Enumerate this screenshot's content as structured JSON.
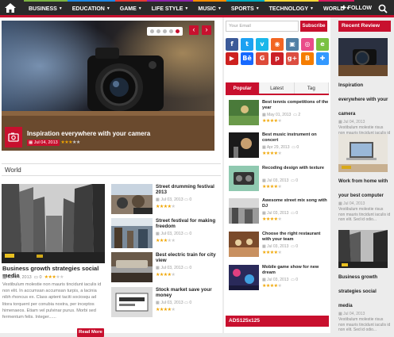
{
  "nav": {
    "items": [
      {
        "label": "BUSINESS",
        "accent": "#7cb342"
      },
      {
        "label": "EDUCATION",
        "accent": "#1e88e5"
      },
      {
        "label": "GAME",
        "accent": "#e53935"
      },
      {
        "label": "LIFE STYLE",
        "accent": "#8e24aa"
      },
      {
        "label": "MUSIC",
        "accent": "#fb8c00"
      },
      {
        "label": "SPORTS",
        "accent": "#00acc1"
      },
      {
        "label": "TECHNOLOGY",
        "accent": "#fdd835"
      },
      {
        "label": "WORLD",
        "accent": "#d81b60"
      }
    ],
    "follow_label": "FOLLOW"
  },
  "colors": {
    "accent": "#c8102e",
    "topbar": "#2a2a2a",
    "star": "#f0a500"
  },
  "hero": {
    "title": "Inspiration everywhere with your camera",
    "date": "Jul 04, 2013",
    "rating": 3,
    "dots": 5,
    "active_dot": 5
  },
  "world": {
    "label": "World",
    "featured": {
      "title": "Business growth strategies social media",
      "date": "Jul 04, 2013",
      "comments": "0",
      "rating": 3,
      "excerpt": "Vestibulum molestie non mauris tincidunt iaculis id non elit. In accumsan accumsan turpis, a lacinia nibh rhoncus ex. Class aptent taciti sociosqu ad litora torquent per conubia nostra, per inceptos himenaeos. Etiam vel pulvinar purus. Morbi sed fermentum felis. Integer......",
      "read_more": "Read More"
    },
    "posts": [
      {
        "title": "Street drumming festival 2013",
        "date": "Jul 03, 2013",
        "comments": "0",
        "rating": 4
      },
      {
        "title": "Street festival for making freedom",
        "date": "Jul 03, 2013",
        "comments": "0",
        "rating": 3
      },
      {
        "title": "Best electric train for city view",
        "date": "Jul 03, 2013",
        "comments": "0",
        "rating": 4
      },
      {
        "title": "Stock market save your money",
        "date": "Jul 03, 2013",
        "comments": "0",
        "rating": 4
      }
    ]
  },
  "sidebar": {
    "email_placeholder": "Your Email",
    "subscribe_label": "Subscribe",
    "social_icons": [
      {
        "name": "facebook-icon",
        "glyph": "f",
        "color": "#3b5998"
      },
      {
        "name": "twitter-icon",
        "glyph": "t",
        "color": "#1da1f2"
      },
      {
        "name": "vimeo-icon",
        "glyph": "v",
        "color": "#1ab7ea"
      },
      {
        "name": "rss-icon",
        "glyph": "◉",
        "color": "#f26522"
      },
      {
        "name": "instagram-icon",
        "glyph": "▣",
        "color": "#517fa4"
      },
      {
        "name": "dribbble-icon",
        "glyph": "◎",
        "color": "#ea4c89"
      },
      {
        "name": "evernote-icon",
        "glyph": "e",
        "color": "#7ac142"
      },
      {
        "name": "youtube-icon",
        "glyph": "▶",
        "color": "#cd201f"
      },
      {
        "name": "behance-icon",
        "glyph": "Bē",
        "color": "#1769ff"
      },
      {
        "name": "google-icon",
        "glyph": "G",
        "color": "#dd4b39"
      },
      {
        "name": "pinterest-icon",
        "glyph": "p",
        "color": "#cb2027"
      },
      {
        "name": "googleplus-icon",
        "glyph": "g+",
        "color": "#dc4e41"
      },
      {
        "name": "blogger-icon",
        "glyph": "B",
        "color": "#f57d00"
      },
      {
        "name": "delicious-icon",
        "glyph": "✚",
        "color": "#3399ff"
      }
    ],
    "tabs": [
      "Popular",
      "Latest",
      "Tag"
    ],
    "active_tab": 0,
    "popular": [
      {
        "title": "Best tennis competitions of the year",
        "date": "May 01, 2013",
        "comments": "2",
        "rating": 4
      },
      {
        "title": "Best music instrument on concert",
        "date": "Apr 29, 2013",
        "comments": "0",
        "rating": 4
      },
      {
        "title": "Recoding design with texture",
        "date": "Jul 03, 2013",
        "comments": "0",
        "rating": 4
      },
      {
        "title": "Awesome street mix song with DJ",
        "date": "Jul 03, 2013",
        "comments": "0",
        "rating": 4
      },
      {
        "title": "Choose the right restaurant with your team",
        "date": "Jul 03, 2013",
        "comments": "0",
        "rating": 4
      },
      {
        "title": "Mobile game show for new dream",
        "date": "Jul 03, 2013",
        "comments": "0",
        "rating": 4
      }
    ],
    "ads_label": "ADS125x125"
  },
  "recent": {
    "heading": "Recent Review",
    "items": [
      {
        "title": "Inspiration everywhere with your camera",
        "date": "Jul 04, 2013",
        "excerpt": "Vestibulum molestie risus non mauris tincidunt iaculis id non elit. Sed id odio..."
      },
      {
        "title": "Work from home with your best computer",
        "date": "Jul 04, 2013",
        "excerpt": "Vestibulum molestie risus non mauris tincidunt iaculis id non elit. Sed id odio..."
      },
      {
        "title": "Business growth strategies social media",
        "date": "Jul 04, 2013",
        "excerpt": "Vestibulum molestie risus non mauris tincidunt iaculis id non elit. Sed id odio..."
      }
    ]
  }
}
